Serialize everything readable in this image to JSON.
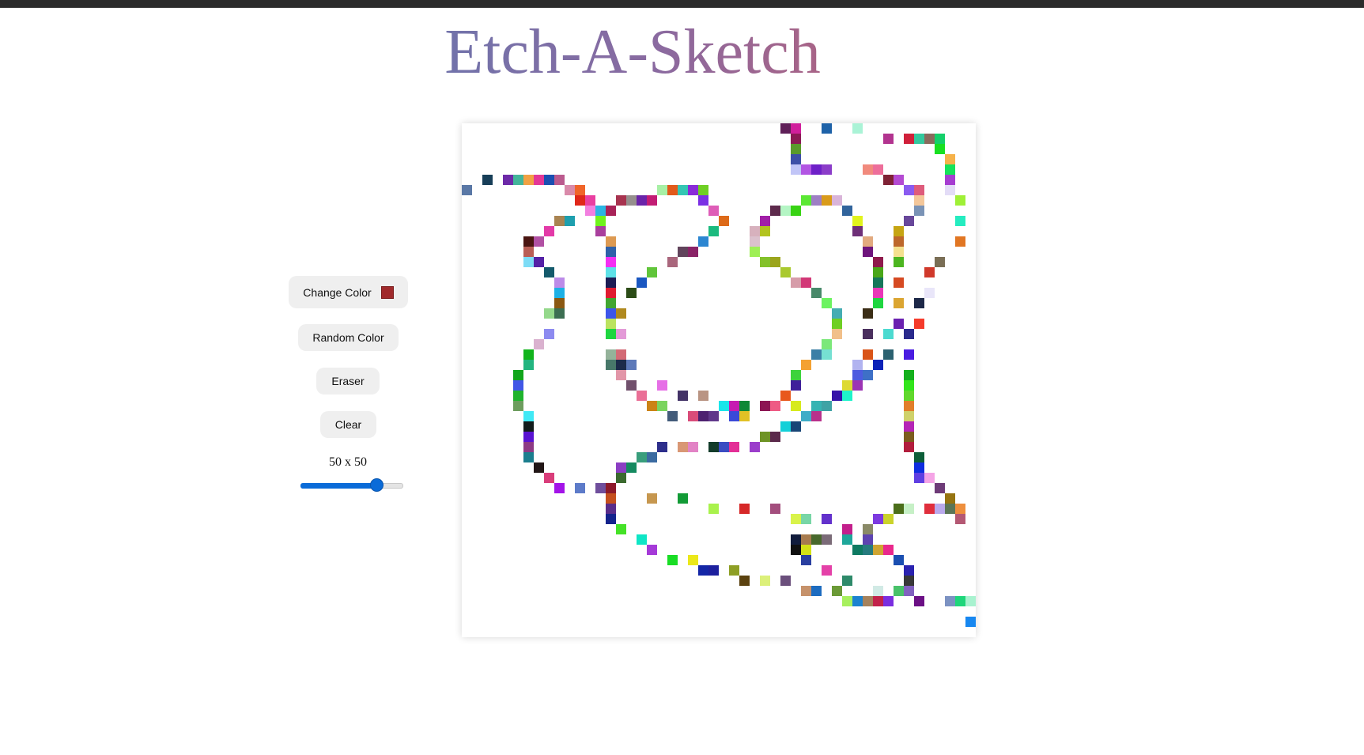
{
  "app": {
    "title": "Etch-A-Sketch"
  },
  "controls": {
    "change_color_label": "Change Color",
    "current_color": "#a02a2c",
    "random_color_label": "Random Color",
    "eraser_label": "Eraser",
    "clear_label": "Clear",
    "grid_size_label": "50 x 50",
    "grid_size_value": 50,
    "slider_fraction": 0.73
  },
  "grid": {
    "columns": 50,
    "rows": 50,
    "background": "#ffffff",
    "painted_cells": [
      [
        31,
        0,
        "#5f1f58"
      ],
      [
        32,
        0,
        "#d01f9c"
      ],
      [
        35,
        0,
        "#1e62a8"
      ],
      [
        38,
        0,
        "#aaf3d6"
      ],
      [
        32,
        1,
        "#8b1a55"
      ],
      [
        41,
        1,
        "#b2348f"
      ],
      [
        43,
        1,
        "#d0203a"
      ],
      [
        44,
        1,
        "#33c99e"
      ],
      [
        45,
        1,
        "#8a6a5d"
      ],
      [
        46,
        1,
        "#14d06a"
      ],
      [
        32,
        2,
        "#5a9a2c"
      ],
      [
        46,
        2,
        "#18e021"
      ],
      [
        32,
        3,
        "#3d4fa7"
      ],
      [
        47,
        3,
        "#f6b24a"
      ],
      [
        32,
        4,
        "#c1c5f7"
      ],
      [
        33,
        4,
        "#b255e3"
      ],
      [
        34,
        4,
        "#6e20c8"
      ],
      [
        35,
        4,
        "#8b3dc9"
      ],
      [
        39,
        4,
        "#f18a7d"
      ],
      [
        40,
        4,
        "#ed6e9a"
      ],
      [
        47,
        4,
        "#16e35a"
      ],
      [
        2,
        5,
        "#173e58"
      ],
      [
        4,
        5,
        "#6d2aa8"
      ],
      [
        5,
        5,
        "#43b59a"
      ],
      [
        6,
        5,
        "#f1a143"
      ],
      [
        7,
        5,
        "#e33796"
      ],
      [
        8,
        5,
        "#1a4fb1"
      ],
      [
        9,
        5,
        "#bb5a8e"
      ],
      [
        41,
        5,
        "#7f2235"
      ],
      [
        42,
        5,
        "#b44ad2"
      ],
      [
        47,
        5,
        "#a63dd1"
      ],
      [
        0,
        6,
        "#5a78a6"
      ],
      [
        10,
        6,
        "#d98aaa"
      ],
      [
        11,
        6,
        "#f0652a"
      ],
      [
        19,
        6,
        "#a7f0a5"
      ],
      [
        20,
        6,
        "#e25a1b"
      ],
      [
        21,
        6,
        "#34c6b3"
      ],
      [
        22,
        6,
        "#8a2bd8"
      ],
      [
        23,
        6,
        "#6fcf24"
      ],
      [
        43,
        6,
        "#8a5bf0"
      ],
      [
        44,
        6,
        "#de5b7c"
      ],
      [
        47,
        6,
        "#e3dcf7"
      ],
      [
        11,
        7,
        "#e0271a"
      ],
      [
        12,
        7,
        "#e93fa1"
      ],
      [
        15,
        7,
        "#a7334f"
      ],
      [
        16,
        7,
        "#958f8d"
      ],
      [
        17,
        7,
        "#6a24a9"
      ],
      [
        18,
        7,
        "#c21d74"
      ],
      [
        23,
        7,
        "#7b2fe4"
      ],
      [
        33,
        7,
        "#5be834"
      ],
      [
        34,
        7,
        "#9e7fc4"
      ],
      [
        35,
        7,
        "#d99b1b"
      ],
      [
        36,
        7,
        "#d9b4d9"
      ],
      [
        44,
        7,
        "#f4c79a"
      ],
      [
        48,
        7,
        "#9ff036"
      ],
      [
        12,
        8,
        "#f27fe0"
      ],
      [
        13,
        8,
        "#2bb5e3"
      ],
      [
        14,
        8,
        "#a82358"
      ],
      [
        24,
        8,
        "#de5db7"
      ],
      [
        30,
        8,
        "#5d2a4c"
      ],
      [
        31,
        8,
        "#b4f5c4"
      ],
      [
        32,
        8,
        "#38d313"
      ],
      [
        37,
        8,
        "#31649c"
      ],
      [
        44,
        8,
        "#7a93b6"
      ],
      [
        9,
        9,
        "#a98452"
      ],
      [
        10,
        9,
        "#1e9fae"
      ],
      [
        13,
        9,
        "#70f31c"
      ],
      [
        25,
        9,
        "#dd6a19"
      ],
      [
        29,
        9,
        "#a11fa7"
      ],
      [
        38,
        9,
        "#e1f31d"
      ],
      [
        43,
        9,
        "#68479a"
      ],
      [
        48,
        9,
        "#25ecc0"
      ],
      [
        8,
        10,
        "#e33aa8"
      ],
      [
        13,
        10,
        "#a93f9d"
      ],
      [
        24,
        10,
        "#1bba7e"
      ],
      [
        28,
        10,
        "#d7b1bd"
      ],
      [
        29,
        10,
        "#b2c31f"
      ],
      [
        38,
        10,
        "#6e2f78"
      ],
      [
        42,
        10,
        "#c6a513"
      ],
      [
        6,
        11,
        "#4a1511"
      ],
      [
        7,
        11,
        "#b150a3"
      ],
      [
        14,
        11,
        "#dd9a52"
      ],
      [
        23,
        11,
        "#2c86d1"
      ],
      [
        28,
        11,
        "#dbc1cd"
      ],
      [
        39,
        11,
        "#e2aa7f"
      ],
      [
        42,
        11,
        "#bd672b"
      ],
      [
        48,
        11,
        "#e17623"
      ],
      [
        6,
        12,
        "#b95e55"
      ],
      [
        14,
        12,
        "#2f61a9"
      ],
      [
        21,
        12,
        "#61445c"
      ],
      [
        22,
        12,
        "#8a2367"
      ],
      [
        28,
        12,
        "#9eef56"
      ],
      [
        39,
        12,
        "#6e147c"
      ],
      [
        42,
        12,
        "#f4e08f"
      ],
      [
        6,
        13,
        "#7ddcf6"
      ],
      [
        7,
        13,
        "#5421a6"
      ],
      [
        14,
        13,
        "#f42ff2"
      ],
      [
        20,
        13,
        "#a9667c"
      ],
      [
        29,
        13,
        "#83c12a"
      ],
      [
        30,
        13,
        "#9ba51d"
      ],
      [
        40,
        13,
        "#8f1a4c"
      ],
      [
        42,
        13,
        "#4cb520"
      ],
      [
        46,
        13,
        "#7a6e55"
      ],
      [
        8,
        14,
        "#145a6c"
      ],
      [
        14,
        14,
        "#5ee1e7"
      ],
      [
        18,
        14,
        "#61c53a"
      ],
      [
        31,
        14,
        "#a9c92e"
      ],
      [
        40,
        14,
        "#4aa719"
      ],
      [
        45,
        14,
        "#d0392b"
      ],
      [
        9,
        15,
        "#bc8be8"
      ],
      [
        14,
        15,
        "#1c1c54"
      ],
      [
        17,
        15,
        "#1a57c1"
      ],
      [
        32,
        15,
        "#d69ca9"
      ],
      [
        33,
        15,
        "#d23877"
      ],
      [
        40,
        15,
        "#16775a"
      ],
      [
        42,
        15,
        "#d64a22"
      ],
      [
        9,
        16,
        "#1cb0e5"
      ],
      [
        14,
        16,
        "#e01b30"
      ],
      [
        16,
        16,
        "#2c4c17"
      ],
      [
        34,
        16,
        "#48896a"
      ],
      [
        40,
        16,
        "#e938b8"
      ],
      [
        45,
        16,
        "#e9e6f9"
      ],
      [
        9,
        17,
        "#8a5812"
      ],
      [
        14,
        17,
        "#41a630"
      ],
      [
        35,
        17,
        "#6cf360"
      ],
      [
        40,
        17,
        "#1fd640"
      ],
      [
        42,
        17,
        "#dba531"
      ],
      [
        44,
        17,
        "#1d2848"
      ],
      [
        8,
        18,
        "#94d88b"
      ],
      [
        9,
        18,
        "#3c6e52"
      ],
      [
        14,
        18,
        "#3d55ea"
      ],
      [
        15,
        18,
        "#b0891f"
      ],
      [
        36,
        18,
        "#45adb3"
      ],
      [
        39,
        18,
        "#3b2d16"
      ],
      [
        14,
        19,
        "#bbe35f"
      ],
      [
        36,
        19,
        "#6fcf24"
      ],
      [
        42,
        19,
        "#6a20b0"
      ],
      [
        44,
        19,
        "#f53b2b"
      ],
      [
        8,
        20,
        "#8d8bf0"
      ],
      [
        14,
        20,
        "#1fd640"
      ],
      [
        15,
        20,
        "#e39ad7"
      ],
      [
        36,
        20,
        "#f1c08a"
      ],
      [
        39,
        20,
        "#4a2f5e"
      ],
      [
        41,
        20,
        "#4cdad0"
      ],
      [
        43,
        20,
        "#2a2a8c"
      ],
      [
        7,
        21,
        "#dab2cf"
      ],
      [
        35,
        21,
        "#7ce87a"
      ],
      [
        6,
        22,
        "#11b41c"
      ],
      [
        14,
        22,
        "#94b29a"
      ],
      [
        15,
        22,
        "#d36a76"
      ],
      [
        34,
        22,
        "#3b7fa6"
      ],
      [
        35,
        22,
        "#76e0d2"
      ],
      [
        39,
        22,
        "#d95418"
      ],
      [
        41,
        22,
        "#2b6170"
      ],
      [
        43,
        22,
        "#4a1de1"
      ],
      [
        6,
        23,
        "#23b580"
      ],
      [
        14,
        23,
        "#48786a"
      ],
      [
        15,
        23,
        "#1c2a4a"
      ],
      [
        16,
        23,
        "#5d79b9"
      ],
      [
        33,
        23,
        "#f4a132"
      ],
      [
        38,
        23,
        "#b1b3f0"
      ],
      [
        40,
        23,
        "#0c23b8"
      ],
      [
        5,
        24,
        "#11a51c"
      ],
      [
        15,
        24,
        "#e296a8"
      ],
      [
        32,
        24,
        "#3dd33c"
      ],
      [
        38,
        24,
        "#4d5be0"
      ],
      [
        39,
        24,
        "#3e70c7"
      ],
      [
        43,
        24,
        "#14b01d"
      ],
      [
        5,
        25,
        "#4157e6"
      ],
      [
        16,
        25,
        "#71506c"
      ],
      [
        19,
        25,
        "#e66fe6"
      ],
      [
        32,
        25,
        "#3f1f9a"
      ],
      [
        37,
        25,
        "#ddda33"
      ],
      [
        38,
        25,
        "#9c34b4"
      ],
      [
        43,
        25,
        "#32e51c"
      ],
      [
        5,
        26,
        "#1fb32d"
      ],
      [
        17,
        26,
        "#ea6f96"
      ],
      [
        21,
        26,
        "#433367"
      ],
      [
        23,
        26,
        "#b99483"
      ],
      [
        31,
        26,
        "#e8581c"
      ],
      [
        36,
        26,
        "#3512a8"
      ],
      [
        37,
        26,
        "#1ef3ca"
      ],
      [
        43,
        26,
        "#60d82c"
      ],
      [
        5,
        27,
        "#6d9d5e"
      ],
      [
        18,
        27,
        "#cc8316"
      ],
      [
        19,
        27,
        "#7bd45f"
      ],
      [
        25,
        27,
        "#19e6ea"
      ],
      [
        26,
        27,
        "#c61bb1"
      ],
      [
        27,
        27,
        "#0f8836"
      ],
      [
        29,
        27,
        "#8c1553"
      ],
      [
        30,
        27,
        "#ee5b84"
      ],
      [
        32,
        27,
        "#d7ea1d"
      ],
      [
        34,
        27,
        "#37b4b3"
      ],
      [
        35,
        27,
        "#3fa3a5"
      ],
      [
        43,
        27,
        "#e17e2a"
      ],
      [
        6,
        28,
        "#40e9f5"
      ],
      [
        20,
        28,
        "#435c7a"
      ],
      [
        22,
        28,
        "#d94c79"
      ],
      [
        23,
        28,
        "#4d2170"
      ],
      [
        24,
        28,
        "#60388a"
      ],
      [
        26,
        28,
        "#3a49d8"
      ],
      [
        27,
        28,
        "#e1c125"
      ],
      [
        33,
        28,
        "#3eadc7"
      ],
      [
        34,
        28,
        "#b8318b"
      ],
      [
        43,
        28,
        "#cfd16a"
      ],
      [
        6,
        29,
        "#131c1c"
      ],
      [
        31,
        29,
        "#13d0d8"
      ],
      [
        32,
        29,
        "#184576"
      ],
      [
        43,
        29,
        "#b525b6"
      ],
      [
        6,
        30,
        "#5913d1"
      ],
      [
        29,
        30,
        "#6e9325"
      ],
      [
        30,
        30,
        "#5b2a4b"
      ],
      [
        43,
        30,
        "#7c5d1e"
      ],
      [
        6,
        31,
        "#8d3a84"
      ],
      [
        19,
        31,
        "#2d2e8b"
      ],
      [
        21,
        31,
        "#d99775"
      ],
      [
        22,
        31,
        "#e283c5"
      ],
      [
        24,
        31,
        "#133c2a"
      ],
      [
        25,
        31,
        "#3a4cc2"
      ],
      [
        26,
        31,
        "#e32f96"
      ],
      [
        28,
        31,
        "#9b3ecb"
      ],
      [
        43,
        31,
        "#b21d3d"
      ],
      [
        6,
        32,
        "#1b7e8e"
      ],
      [
        17,
        32,
        "#399e7c"
      ],
      [
        18,
        32,
        "#3b6ba1"
      ],
      [
        44,
        32,
        "#0d5e38"
      ],
      [
        7,
        33,
        "#221717"
      ],
      [
        15,
        33,
        "#8b3ec3"
      ],
      [
        16,
        33,
        "#158a60"
      ],
      [
        44,
        33,
        "#0e2de0"
      ],
      [
        8,
        34,
        "#d93d7a"
      ],
      [
        15,
        34,
        "#3b6a2f"
      ],
      [
        44,
        34,
        "#5f3ee2"
      ],
      [
        45,
        34,
        "#f5a4e6"
      ],
      [
        9,
        35,
        "#a313e8"
      ],
      [
        11,
        35,
        "#5d7bc9"
      ],
      [
        13,
        35,
        "#6f4e9c"
      ],
      [
        14,
        35,
        "#8c1a2a"
      ],
      [
        46,
        35,
        "#6e3b78"
      ],
      [
        14,
        36,
        "#c5501e"
      ],
      [
        18,
        36,
        "#c6974f"
      ],
      [
        21,
        36,
        "#129b36"
      ],
      [
        47,
        36,
        "#967411"
      ],
      [
        14,
        37,
        "#5a2d8a"
      ],
      [
        24,
        37,
        "#a9f24c"
      ],
      [
        27,
        37,
        "#d62828"
      ],
      [
        30,
        37,
        "#a34e7d"
      ],
      [
        42,
        37,
        "#4b6e1a"
      ],
      [
        43,
        37,
        "#c6f0c6"
      ],
      [
        45,
        37,
        "#e02e3c"
      ],
      [
        46,
        37,
        "#b9a9ec"
      ],
      [
        47,
        37,
        "#5b7556"
      ],
      [
        48,
        37,
        "#ee8f3d"
      ],
      [
        14,
        38,
        "#14238c"
      ],
      [
        32,
        38,
        "#d9f34a"
      ],
      [
        33,
        38,
        "#78d6a6"
      ],
      [
        35,
        38,
        "#6331cc"
      ],
      [
        40,
        38,
        "#7d3ae0"
      ],
      [
        41,
        38,
        "#cbd32b"
      ],
      [
        48,
        38,
        "#b45873"
      ],
      [
        15,
        39,
        "#45e227"
      ],
      [
        37,
        39,
        "#c31f8c"
      ],
      [
        39,
        39,
        "#8a8a67"
      ],
      [
        17,
        40,
        "#0ee6c6"
      ],
      [
        32,
        40,
        "#111c3c"
      ],
      [
        33,
        40,
        "#a77b4f"
      ],
      [
        34,
        40,
        "#48682c"
      ],
      [
        35,
        40,
        "#7b6b78"
      ],
      [
        37,
        40,
        "#1ea79a"
      ],
      [
        39,
        40,
        "#5d43b1"
      ],
      [
        18,
        41,
        "#a53ad8"
      ],
      [
        32,
        41,
        "#101010"
      ],
      [
        33,
        41,
        "#d4e216"
      ],
      [
        38,
        41,
        "#0e7a62"
      ],
      [
        39,
        41,
        "#267b7e"
      ],
      [
        40,
        41,
        "#cfa531"
      ],
      [
        41,
        41,
        "#e9288c"
      ],
      [
        20,
        42,
        "#19dd25"
      ],
      [
        22,
        42,
        "#ebe81a"
      ],
      [
        33,
        42,
        "#2a3fa0"
      ],
      [
        42,
        42,
        "#1a4fb1"
      ],
      [
        23,
        43,
        "#1426a6"
      ],
      [
        24,
        43,
        "#1d209e"
      ],
      [
        26,
        43,
        "#8e9f25"
      ],
      [
        35,
        43,
        "#e441a8"
      ],
      [
        43,
        43,
        "#2a22b0"
      ],
      [
        27,
        44,
        "#5b4210"
      ],
      [
        29,
        44,
        "#dcf07a"
      ],
      [
        31,
        44,
        "#6b4f7c"
      ],
      [
        37,
        44,
        "#2e8a6a"
      ],
      [
        43,
        44,
        "#383838"
      ],
      [
        33,
        45,
        "#c6926b"
      ],
      [
        34,
        45,
        "#1d6cc0"
      ],
      [
        36,
        45,
        "#6b9a37"
      ],
      [
        40,
        45,
        "#d1eae5"
      ],
      [
        42,
        45,
        "#49c26a"
      ],
      [
        43,
        45,
        "#8161bf"
      ],
      [
        37,
        46,
        "#a7f05e"
      ],
      [
        38,
        46,
        "#1b82d0"
      ],
      [
        39,
        46,
        "#a6825c"
      ],
      [
        40,
        46,
        "#c2224a"
      ],
      [
        41,
        46,
        "#7a2ee0"
      ],
      [
        44,
        46,
        "#6b0f85"
      ],
      [
        47,
        46,
        "#7c92c2"
      ],
      [
        48,
        46,
        "#1ed67a"
      ],
      [
        49,
        46,
        "#a8f2cf"
      ],
      [
        49,
        48,
        "#1787f0"
      ]
    ]
  }
}
